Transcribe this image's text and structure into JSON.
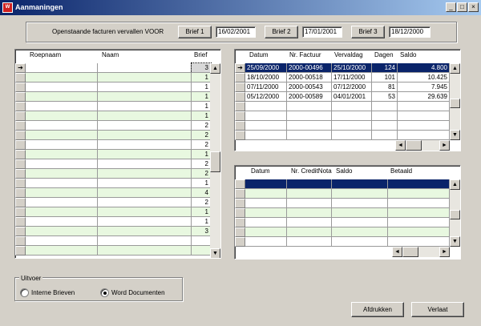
{
  "window": {
    "title": "Aanmaningen",
    "app_icon": "report-icon"
  },
  "header": {
    "label": "Openstaande facturen vervallen VOOR",
    "brieven": [
      {
        "label": "Brief 1",
        "date": "16/02/2001"
      },
      {
        "label": "Brief 2",
        "date": "17/01/2001"
      },
      {
        "label": "Brief 3",
        "date": "18/12/2000"
      }
    ]
  },
  "customers": {
    "columns": [
      "Roepnaam",
      "Naam",
      "Brief"
    ],
    "brief_values": [
      "3",
      "1",
      "1",
      "1",
      "1",
      "1",
      "2",
      "2",
      "2",
      "1",
      "2",
      "2",
      "1",
      "4",
      "2",
      "1",
      "1",
      "3",
      "",
      ""
    ]
  },
  "invoices": {
    "columns": [
      "Datum",
      "Nr. Factuur",
      "Vervaldag",
      "Dagen",
      "Saldo"
    ],
    "rows": [
      {
        "datum": "25/09/2000",
        "nr": "2000-00496",
        "verval": "25/10/2000",
        "dagen": "124",
        "saldo": "4.800"
      },
      {
        "datum": "18/10/2000",
        "nr": "2000-00518",
        "verval": "17/11/2000",
        "dagen": "101",
        "saldo": "10.425"
      },
      {
        "datum": "07/11/2000",
        "nr": "2000-00543",
        "verval": "07/12/2000",
        "dagen": "81",
        "saldo": "7.945"
      },
      {
        "datum": "05/12/2000",
        "nr": "2000-00589",
        "verval": "04/01/2001",
        "dagen": "53",
        "saldo": "29.639"
      }
    ]
  },
  "credits": {
    "columns": [
      "Datum",
      "Nr. CreditNota",
      "Saldo",
      "Betaald"
    ]
  },
  "uitvoer": {
    "label": "Uitvoer",
    "options": [
      {
        "label": "Interne Brieven",
        "selected": false
      },
      {
        "label": "Word Documenten",
        "selected": true
      }
    ]
  },
  "buttons": {
    "print": "Afdrukken",
    "exit": "Verlaat"
  }
}
